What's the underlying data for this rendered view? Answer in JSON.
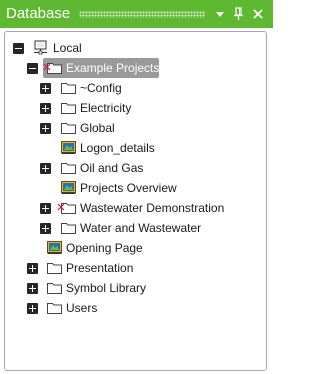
{
  "panel": {
    "title": "Database"
  },
  "colors": {
    "titlebar": "#5fb832",
    "selection": "#9a9a9a"
  },
  "tree": {
    "root": "Local",
    "example_projects": "Example Projects",
    "config": "~Config",
    "electricity": "Electricity",
    "global": "Global",
    "logon_details": "Logon_details",
    "oil_and_gas": "Oil and Gas",
    "projects_overview": "Projects Overview",
    "wastewater_demonstration": "Wastewater Demonstration",
    "water_and_wastewater": "Water and Wastewater",
    "opening_page": "Opening Page",
    "presentation": "Presentation",
    "symbol_library": "Symbol Library",
    "users": "Users"
  }
}
